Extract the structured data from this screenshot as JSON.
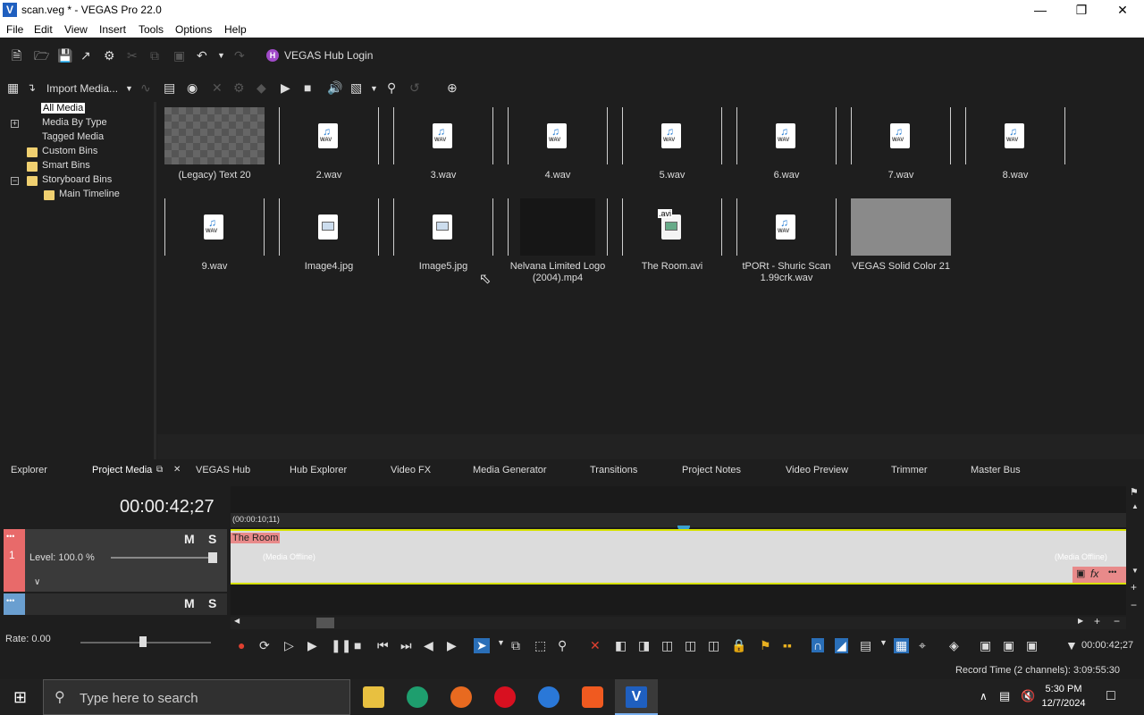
{
  "window": {
    "title": "scan.veg * - VEGAS Pro 22.0",
    "app_icon": "V"
  },
  "menu": [
    "File",
    "Edit",
    "View",
    "Insert",
    "Tools",
    "Options",
    "Help"
  ],
  "toolbar": {
    "hub_login": "VEGAS Hub Login",
    "hub_icon": "H"
  },
  "media_toolbar": {
    "import_media": "Import Media..."
  },
  "tree": {
    "items": [
      "All Media",
      "Media By Type",
      "Tagged Media",
      "Custom Bins",
      "Smart Bins",
      "Storyboard Bins",
      "Main Timeline"
    ]
  },
  "media": {
    "items": [
      {
        "name": "(Legacy) Text 20",
        "type": "text"
      },
      {
        "name": "2.wav",
        "type": "wav"
      },
      {
        "name": "3.wav",
        "type": "wav"
      },
      {
        "name": "4.wav",
        "type": "wav"
      },
      {
        "name": "5.wav",
        "type": "wav"
      },
      {
        "name": "6.wav",
        "type": "wav"
      },
      {
        "name": "7.wav",
        "type": "wav"
      },
      {
        "name": "8.wav",
        "type": "wav"
      },
      {
        "name": "9.wav",
        "type": "wav"
      },
      {
        "name": "Image4.jpg",
        "type": "jpg"
      },
      {
        "name": "Image5.jpg",
        "type": "jpg"
      },
      {
        "name": "Nelvana Limited Logo (2004).mp4",
        "type": "video"
      },
      {
        "name": "The Room.avi",
        "type": "avi"
      },
      {
        "name": "tPORt - Shuric Scan 1.99crk.wav",
        "type": "wav"
      },
      {
        "name": "VEGAS Solid Color 21",
        "type": "solid"
      }
    ],
    "wav_label": "WAV",
    "avi_label": ".avi"
  },
  "tabs": [
    "Explorer",
    "Project Media",
    "VEGAS Hub",
    "Hub Explorer",
    "Video FX",
    "Media Generator",
    "Transitions",
    "Project Notes",
    "Video Preview",
    "Trimmer",
    "Master Bus"
  ],
  "timeline": {
    "timecode": "00:00:42;27",
    "ruler_label": "(00:00:10;11)",
    "track1": {
      "level": "Level: 100.0 %",
      "m": "M",
      "s": "S",
      "number": "1"
    },
    "track2": {
      "m": "M",
      "s": "S"
    },
    "event_name": "The Room",
    "offline_label": "(Media Offline)",
    "rate": "Rate: 0.00",
    "end_time": "00:00:42;27"
  },
  "status": {
    "record_time": "Record Time (2 channels): 3:09:55:30"
  },
  "taskbar": {
    "search_placeholder": "Type here to search",
    "time": "5:30 PM",
    "date": "12/7/2024"
  }
}
